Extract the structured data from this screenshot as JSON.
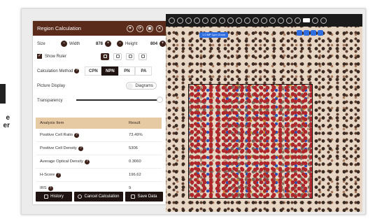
{
  "left_caption": [
    "e",
    "er"
  ],
  "viewer": {
    "scale_label": "1.0 MP 1μm·Zoom",
    "toolbar_icons": [
      "tool-icon",
      "tool-icon",
      "tool-icon",
      "tool-icon",
      "tool-icon",
      "tool-icon",
      "tool-icon",
      "tool-icon",
      "tool-icon",
      "tool-icon",
      "tool-icon",
      "tool-icon",
      "tool-icon",
      "tool-icon",
      "tool-icon",
      "tool-icon",
      "tool-icon",
      "tool-icon",
      "tool-icon",
      "tool-icon",
      "tool-icon"
    ]
  },
  "panel": {
    "title": "Region Calculation",
    "header_icons": [
      "magic-wand-icon",
      "refresh-icon",
      "save-icon",
      "close-icon"
    ],
    "size_label": "Size",
    "width_label": "Width",
    "width_value": "878",
    "height_label": "Height",
    "height_value": "804",
    "show_ruler_label": "Show Ruler",
    "calc_method_label": "Calculation Method",
    "methods": [
      "CPN",
      "NPN",
      "PN",
      "PA"
    ],
    "active_method": "NPN",
    "picture_display_label": "Picture Display",
    "picture_display_value": "Diagrams",
    "transparency_label": "Transparency",
    "transparency_level": 0.95,
    "table_headers": [
      "Analysis Item",
      "Result"
    ],
    "rows": [
      {
        "item": "Positive Cell Ratio",
        "value": "73.49%"
      },
      {
        "item": "Positive Cell Density",
        "value": "5306"
      },
      {
        "item": "Average Optical Density",
        "value": "0.3060"
      },
      {
        "item": "H-Score",
        "value": "196.62"
      },
      {
        "item": "IRS",
        "value": "9"
      }
    ],
    "buttons": {
      "history": "History",
      "cancel": "Cancel Calculation",
      "save": "Save Data"
    },
    "colors": {
      "header": "#5a2a1a",
      "active": "#1f1411",
      "table_header": "#e6caa4"
    }
  }
}
